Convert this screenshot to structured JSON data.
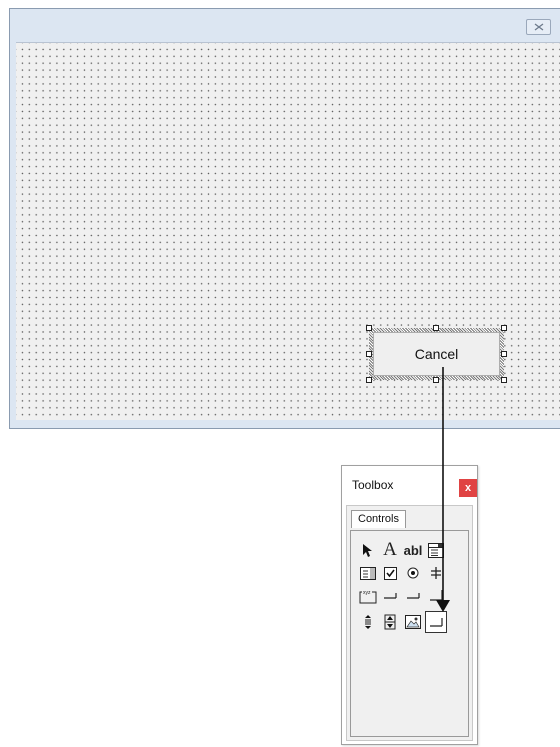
{
  "form": {
    "cancel_button_label": "Cancel"
  },
  "toolbox": {
    "title": "Toolbox",
    "close_label": "x",
    "tab_label": "Controls",
    "tools": [
      {
        "icon": "select-objects-icon"
      },
      {
        "icon": "label-icon",
        "glyph": "A"
      },
      {
        "icon": "textbox-icon",
        "glyph": "abl"
      },
      {
        "icon": "combobox-icon"
      },
      {
        "icon": "listbox-icon"
      },
      {
        "icon": "checkbox-icon"
      },
      {
        "icon": "optionbutton-icon"
      },
      {
        "icon": "togglebutton-icon"
      },
      {
        "icon": "frame-icon",
        "glyph": "xyz"
      },
      {
        "icon": "commandbutton-icon"
      },
      {
        "icon": "tabstrip-icon"
      },
      {
        "icon": "multipage-icon"
      },
      {
        "icon": "scrollbar-icon"
      },
      {
        "icon": "spinbutton-icon"
      },
      {
        "icon": "image-icon"
      },
      {
        "icon": "refedit-icon"
      }
    ]
  }
}
